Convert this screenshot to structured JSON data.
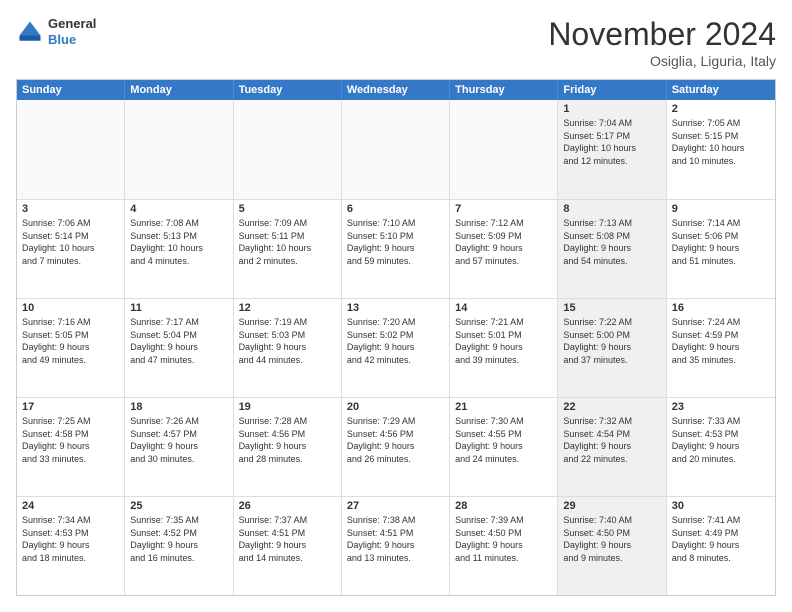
{
  "header": {
    "logo": {
      "general": "General",
      "blue": "Blue"
    },
    "title": "November 2024",
    "subtitle": "Osiglia, Liguria, Italy"
  },
  "weekdays": [
    "Sunday",
    "Monday",
    "Tuesday",
    "Wednesday",
    "Thursday",
    "Friday",
    "Saturday"
  ],
  "rows": [
    [
      {
        "num": "",
        "info": "",
        "empty": true
      },
      {
        "num": "",
        "info": "",
        "empty": true
      },
      {
        "num": "",
        "info": "",
        "empty": true
      },
      {
        "num": "",
        "info": "",
        "empty": true
      },
      {
        "num": "",
        "info": "",
        "empty": true
      },
      {
        "num": "1",
        "info": "Sunrise: 7:04 AM\nSunset: 5:17 PM\nDaylight: 10 hours\nand 12 minutes.",
        "shaded": true
      },
      {
        "num": "2",
        "info": "Sunrise: 7:05 AM\nSunset: 5:15 PM\nDaylight: 10 hours\nand 10 minutes.",
        "shaded": false
      }
    ],
    [
      {
        "num": "3",
        "info": "Sunrise: 7:06 AM\nSunset: 5:14 PM\nDaylight: 10 hours\nand 7 minutes.",
        "shaded": false
      },
      {
        "num": "4",
        "info": "Sunrise: 7:08 AM\nSunset: 5:13 PM\nDaylight: 10 hours\nand 4 minutes.",
        "shaded": false
      },
      {
        "num": "5",
        "info": "Sunrise: 7:09 AM\nSunset: 5:11 PM\nDaylight: 10 hours\nand 2 minutes.",
        "shaded": false
      },
      {
        "num": "6",
        "info": "Sunrise: 7:10 AM\nSunset: 5:10 PM\nDaylight: 9 hours\nand 59 minutes.",
        "shaded": false
      },
      {
        "num": "7",
        "info": "Sunrise: 7:12 AM\nSunset: 5:09 PM\nDaylight: 9 hours\nand 57 minutes.",
        "shaded": false
      },
      {
        "num": "8",
        "info": "Sunrise: 7:13 AM\nSunset: 5:08 PM\nDaylight: 9 hours\nand 54 minutes.",
        "shaded": true
      },
      {
        "num": "9",
        "info": "Sunrise: 7:14 AM\nSunset: 5:06 PM\nDaylight: 9 hours\nand 51 minutes.",
        "shaded": false
      }
    ],
    [
      {
        "num": "10",
        "info": "Sunrise: 7:16 AM\nSunset: 5:05 PM\nDaylight: 9 hours\nand 49 minutes.",
        "shaded": false
      },
      {
        "num": "11",
        "info": "Sunrise: 7:17 AM\nSunset: 5:04 PM\nDaylight: 9 hours\nand 47 minutes.",
        "shaded": false
      },
      {
        "num": "12",
        "info": "Sunrise: 7:19 AM\nSunset: 5:03 PM\nDaylight: 9 hours\nand 44 minutes.",
        "shaded": false
      },
      {
        "num": "13",
        "info": "Sunrise: 7:20 AM\nSunset: 5:02 PM\nDaylight: 9 hours\nand 42 minutes.",
        "shaded": false
      },
      {
        "num": "14",
        "info": "Sunrise: 7:21 AM\nSunset: 5:01 PM\nDaylight: 9 hours\nand 39 minutes.",
        "shaded": false
      },
      {
        "num": "15",
        "info": "Sunrise: 7:22 AM\nSunset: 5:00 PM\nDaylight: 9 hours\nand 37 minutes.",
        "shaded": true
      },
      {
        "num": "16",
        "info": "Sunrise: 7:24 AM\nSunset: 4:59 PM\nDaylight: 9 hours\nand 35 minutes.",
        "shaded": false
      }
    ],
    [
      {
        "num": "17",
        "info": "Sunrise: 7:25 AM\nSunset: 4:58 PM\nDaylight: 9 hours\nand 33 minutes.",
        "shaded": false
      },
      {
        "num": "18",
        "info": "Sunrise: 7:26 AM\nSunset: 4:57 PM\nDaylight: 9 hours\nand 30 minutes.",
        "shaded": false
      },
      {
        "num": "19",
        "info": "Sunrise: 7:28 AM\nSunset: 4:56 PM\nDaylight: 9 hours\nand 28 minutes.",
        "shaded": false
      },
      {
        "num": "20",
        "info": "Sunrise: 7:29 AM\nSunset: 4:56 PM\nDaylight: 9 hours\nand 26 minutes.",
        "shaded": false
      },
      {
        "num": "21",
        "info": "Sunrise: 7:30 AM\nSunset: 4:55 PM\nDaylight: 9 hours\nand 24 minutes.",
        "shaded": false
      },
      {
        "num": "22",
        "info": "Sunrise: 7:32 AM\nSunset: 4:54 PM\nDaylight: 9 hours\nand 22 minutes.",
        "shaded": true
      },
      {
        "num": "23",
        "info": "Sunrise: 7:33 AM\nSunset: 4:53 PM\nDaylight: 9 hours\nand 20 minutes.",
        "shaded": false
      }
    ],
    [
      {
        "num": "24",
        "info": "Sunrise: 7:34 AM\nSunset: 4:53 PM\nDaylight: 9 hours\nand 18 minutes.",
        "shaded": false
      },
      {
        "num": "25",
        "info": "Sunrise: 7:35 AM\nSunset: 4:52 PM\nDaylight: 9 hours\nand 16 minutes.",
        "shaded": false
      },
      {
        "num": "26",
        "info": "Sunrise: 7:37 AM\nSunset: 4:51 PM\nDaylight: 9 hours\nand 14 minutes.",
        "shaded": false
      },
      {
        "num": "27",
        "info": "Sunrise: 7:38 AM\nSunset: 4:51 PM\nDaylight: 9 hours\nand 13 minutes.",
        "shaded": false
      },
      {
        "num": "28",
        "info": "Sunrise: 7:39 AM\nSunset: 4:50 PM\nDaylight: 9 hours\nand 11 minutes.",
        "shaded": false
      },
      {
        "num": "29",
        "info": "Sunrise: 7:40 AM\nSunset: 4:50 PM\nDaylight: 9 hours\nand 9 minutes.",
        "shaded": true
      },
      {
        "num": "30",
        "info": "Sunrise: 7:41 AM\nSunset: 4:49 PM\nDaylight: 9 hours\nand 8 minutes.",
        "shaded": false
      }
    ]
  ]
}
